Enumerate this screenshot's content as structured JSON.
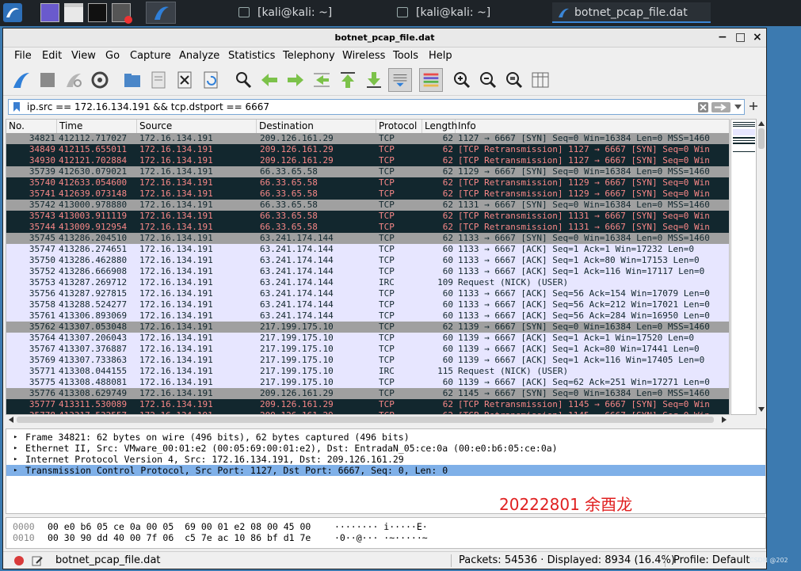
{
  "taskbar": {
    "windows": [
      {
        "label": "[kali@kali: ~]"
      },
      {
        "label": "[kali@kali: ~]"
      },
      {
        "label": "botnet_pcap_file.dat"
      }
    ]
  },
  "window": {
    "title": "botnet_pcap_file.dat",
    "controls": {
      "minimize": "−",
      "maximize": "□",
      "close": "×"
    }
  },
  "menu": [
    "File",
    "Edit",
    "View",
    "Go",
    "Capture",
    "Analyze",
    "Statistics",
    "Telephony",
    "Wireless",
    "Tools",
    "Help"
  ],
  "filter": {
    "value": "ip.src == 172.16.134.191 && tcp.dstport == 6667"
  },
  "columns": [
    "No.",
    "Time",
    "Source",
    "Destination",
    "Protocol",
    "Length",
    "Info"
  ],
  "packets": [
    {
      "style": "sel",
      "no": "34821",
      "time": "412112.717027",
      "src": "172.16.134.191",
      "dst": "209.126.161.29",
      "proto": "TCP",
      "len": "62",
      "info": "1127 → 6667 [SYN] Seq=0 Win=16384 Len=0 MSS=1460"
    },
    {
      "style": "dark",
      "no": "34849",
      "time": "412115.655011",
      "src": "172.16.134.191",
      "dst": "209.126.161.29",
      "proto": "TCP",
      "len": "62",
      "info": "[TCP Retransmission] 1127 → 6667 [SYN] Seq=0 Win"
    },
    {
      "style": "dark",
      "no": "34930",
      "time": "412121.702884",
      "src": "172.16.134.191",
      "dst": "209.126.161.29",
      "proto": "TCP",
      "len": "62",
      "info": "[TCP Retransmission] 1127 → 6667 [SYN] Seq=0 Win"
    },
    {
      "style": "gray",
      "no": "35739",
      "time": "412630.079021",
      "src": "172.16.134.191",
      "dst": "66.33.65.58",
      "proto": "TCP",
      "len": "62",
      "info": "1129 → 6667 [SYN] Seq=0 Win=16384 Len=0 MSS=1460"
    },
    {
      "style": "dark",
      "no": "35740",
      "time": "412633.054600",
      "src": "172.16.134.191",
      "dst": "66.33.65.58",
      "proto": "TCP",
      "len": "62",
      "info": "[TCP Retransmission] 1129 → 6667 [SYN] Seq=0 Win"
    },
    {
      "style": "dark",
      "no": "35741",
      "time": "412639.073148",
      "src": "172.16.134.191",
      "dst": "66.33.65.58",
      "proto": "TCP",
      "len": "62",
      "info": "[TCP Retransmission] 1129 → 6667 [SYN] Seq=0 Win"
    },
    {
      "style": "gray",
      "no": "35742",
      "time": "413000.978880",
      "src": "172.16.134.191",
      "dst": "66.33.65.58",
      "proto": "TCP",
      "len": "62",
      "info": "1131 → 6667 [SYN] Seq=0 Win=16384 Len=0 MSS=1460"
    },
    {
      "style": "dark",
      "no": "35743",
      "time": "413003.911119",
      "src": "172.16.134.191",
      "dst": "66.33.65.58",
      "proto": "TCP",
      "len": "62",
      "info": "[TCP Retransmission] 1131 → 6667 [SYN] Seq=0 Win"
    },
    {
      "style": "dark",
      "no": "35744",
      "time": "413009.912954",
      "src": "172.16.134.191",
      "dst": "66.33.65.58",
      "proto": "TCP",
      "len": "62",
      "info": "[TCP Retransmission] 1131 → 6667 [SYN] Seq=0 Win"
    },
    {
      "style": "gray",
      "no": "35745",
      "time": "413286.204510",
      "src": "172.16.134.191",
      "dst": "63.241.174.144",
      "proto": "TCP",
      "len": "62",
      "info": "1133 → 6667 [SYN] Seq=0 Win=16384 Len=0 MSS=1460"
    },
    {
      "style": "lav",
      "no": "35747",
      "time": "413286.274651",
      "src": "172.16.134.191",
      "dst": "63.241.174.144",
      "proto": "TCP",
      "len": "60",
      "info": "1133 → 6667 [ACK] Seq=1 Ack=1 Win=17232 Len=0"
    },
    {
      "style": "lav",
      "no": "35750",
      "time": "413286.462880",
      "src": "172.16.134.191",
      "dst": "63.241.174.144",
      "proto": "TCP",
      "len": "60",
      "info": "1133 → 6667 [ACK] Seq=1 Ack=80 Win=17153 Len=0"
    },
    {
      "style": "lav",
      "no": "35752",
      "time": "413286.666908",
      "src": "172.16.134.191",
      "dst": "63.241.174.144",
      "proto": "TCP",
      "len": "60",
      "info": "1133 → 6667 [ACK] Seq=1 Ack=116 Win=17117 Len=0"
    },
    {
      "style": "lav",
      "no": "35753",
      "time": "413287.269712",
      "src": "172.16.134.191",
      "dst": "63.241.174.144",
      "proto": "IRC",
      "len": "109",
      "info": "Request (NICK) (USER)"
    },
    {
      "style": "lav",
      "no": "35756",
      "time": "413287.927815",
      "src": "172.16.134.191",
      "dst": "63.241.174.144",
      "proto": "TCP",
      "len": "60",
      "info": "1133 → 6667 [ACK] Seq=56 Ack=154 Win=17079 Len=0"
    },
    {
      "style": "lav",
      "no": "35758",
      "time": "413288.524277",
      "src": "172.16.134.191",
      "dst": "63.241.174.144",
      "proto": "TCP",
      "len": "60",
      "info": "1133 → 6667 [ACK] Seq=56 Ack=212 Win=17021 Len=0"
    },
    {
      "style": "lav",
      "no": "35761",
      "time": "413306.893069",
      "src": "172.16.134.191",
      "dst": "63.241.174.144",
      "proto": "TCP",
      "len": "60",
      "info": "1133 → 6667 [ACK] Seq=56 Ack=284 Win=16950 Len=0"
    },
    {
      "style": "gray",
      "no": "35762",
      "time": "413307.053048",
      "src": "172.16.134.191",
      "dst": "217.199.175.10",
      "proto": "TCP",
      "len": "62",
      "info": "1139 → 6667 [SYN] Seq=0 Win=16384 Len=0 MSS=1460"
    },
    {
      "style": "lav",
      "no": "35764",
      "time": "413307.206043",
      "src": "172.16.134.191",
      "dst": "217.199.175.10",
      "proto": "TCP",
      "len": "60",
      "info": "1139 → 6667 [ACK] Seq=1 Ack=1 Win=17520 Len=0"
    },
    {
      "style": "lav",
      "no": "35767",
      "time": "413307.376887",
      "src": "172.16.134.191",
      "dst": "217.199.175.10",
      "proto": "TCP",
      "len": "60",
      "info": "1139 → 6667 [ACK] Seq=1 Ack=80 Win=17441 Len=0"
    },
    {
      "style": "lav",
      "no": "35769",
      "time": "413307.733863",
      "src": "172.16.134.191",
      "dst": "217.199.175.10",
      "proto": "TCP",
      "len": "60",
      "info": "1139 → 6667 [ACK] Seq=1 Ack=116 Win=17405 Len=0"
    },
    {
      "style": "lav",
      "no": "35771",
      "time": "413308.044155",
      "src": "172.16.134.191",
      "dst": "217.199.175.10",
      "proto": "IRC",
      "len": "115",
      "info": "Request (NICK) (USER)"
    },
    {
      "style": "lav",
      "no": "35775",
      "time": "413308.488081",
      "src": "172.16.134.191",
      "dst": "217.199.175.10",
      "proto": "TCP",
      "len": "60",
      "info": "1139 → 6667 [ACK] Seq=62 Ack=251 Win=17271 Len=0"
    },
    {
      "style": "gray",
      "no": "35776",
      "time": "413308.629749",
      "src": "172.16.134.191",
      "dst": "209.126.161.29",
      "proto": "TCP",
      "len": "62",
      "info": "1145 → 6667 [SYN] Seq=0 Win=16384 Len=0 MSS=1460"
    },
    {
      "style": "dark",
      "no": "35777",
      "time": "413311.530089",
      "src": "172.16.134.191",
      "dst": "209.126.161.29",
      "proto": "TCP",
      "len": "62",
      "info": "[TCP Retransmission] 1145 → 6667 [SYN] Seq=0 Win"
    },
    {
      "style": "dark",
      "no": "35778",
      "time": "413317.532557",
      "src": "172.16.134.191",
      "dst": "209.126.161.29",
      "proto": "TCP",
      "len": "62",
      "info": "[TCP Retransmission] 1145 → 6667 [SYN] Seq=0 Win"
    }
  ],
  "details": [
    {
      "text": "Frame 34821: 62 bytes on wire (496 bits), 62 bytes captured (496 bits)",
      "highlighted": false
    },
    {
      "text": "Ethernet II, Src: VMware_00:01:e2 (00:05:69:00:01:e2), Dst: EntradaN_05:ce:0a (00:e0:b6:05:ce:0a)",
      "highlighted": false
    },
    {
      "text": "Internet Protocol Version 4, Src: 172.16.134.191, Dst: 209.126.161.29",
      "highlighted": false
    },
    {
      "text": "Transmission Control Protocol, Src Port: 1127, Dst Port: 6667, Seq: 0, Len: 0",
      "highlighted": true
    }
  ],
  "watermark": "20222801 余酉龙",
  "bytes": [
    {
      "offset": "0000",
      "hex": "00 e0 b6 05 ce 0a 00 05  69 00 01 e2 08 00 45 00",
      "ascii": "········ i·····E·"
    },
    {
      "offset": "0010",
      "hex": "00 30 90 dd 40 00 7f 06  c5 7e ac 10 86 bf d1 7e",
      "ascii": "·0··@··· ·~·····~"
    }
  ],
  "status": {
    "file": "botnet_pcap_file.dat",
    "packets": "Packets: 54536 · Displayed: 8934 (16.4%)",
    "profile": "Profile: Default"
  },
  "csdn": "CSDN @202"
}
